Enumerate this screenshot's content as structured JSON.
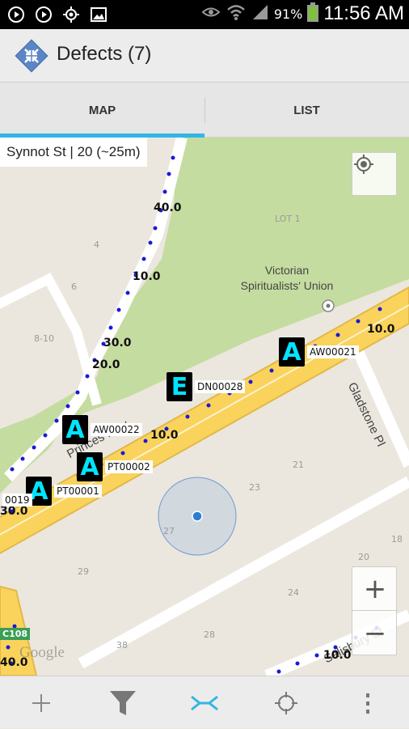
{
  "status_bar": {
    "icons_left": [
      "play-circle-icon",
      "play-circle-icon",
      "gps-icon",
      "image-icon"
    ],
    "battery_text": "91%",
    "time": "11:56 AM",
    "icons_right": [
      "eye-icon",
      "wifi-icon",
      "signal-icon",
      "battery-icon"
    ]
  },
  "action_bar": {
    "title": "Defects (7)",
    "icon": "collapse-arrows-icon",
    "accent_color": "#5b86c5"
  },
  "tabs": [
    {
      "label": "MAP",
      "active": true
    },
    {
      "label": "LIST",
      "active": false
    }
  ],
  "tab_indicator_color": "#33b5e5",
  "map": {
    "street_label": "Synnot St | 20 (~25m)",
    "markers": [
      {
        "letter": "A",
        "label": "AW00021"
      },
      {
        "letter": "E",
        "label": "DN00028"
      },
      {
        "letter": "A",
        "label": "AW00022"
      },
      {
        "letter": "A",
        "label": "PT00002"
      },
      {
        "letter": "A",
        "label": "PT00001"
      }
    ],
    "partial_marker_label": "0019",
    "distances": [
      "40.0",
      "10.0",
      "30.0",
      "20.0",
      "10.0",
      "10.0",
      "30.0",
      "40.0",
      "10.0"
    ],
    "poi": {
      "name_line1": "Victorian",
      "name_line2": "Spiritualists' Union"
    },
    "lot_label": "LOT 1",
    "lot_numbers": [
      "4",
      "6",
      "8-10",
      "21",
      "23",
      "27",
      "29",
      "28",
      "24",
      "20",
      "18",
      "38"
    ],
    "street_names": {
      "princes": "Princes Hwy",
      "gladstone": "Gladstone Pl",
      "salisbury": "Salisbury St"
    },
    "road_shield": "C108",
    "google_logo": "Google",
    "zoom_in": "+",
    "zoom_out": "−",
    "colors": {
      "park": "#c5dca0",
      "road": "#f9d35c",
      "background": "#ebe7df",
      "marker_text": "#00e5ff",
      "dot": "#1a1ad8"
    }
  },
  "bottom_bar": {
    "buttons": [
      "add-icon",
      "filter-icon",
      "collapse-icon",
      "locate-icon",
      "overflow-menu-icon"
    ]
  }
}
